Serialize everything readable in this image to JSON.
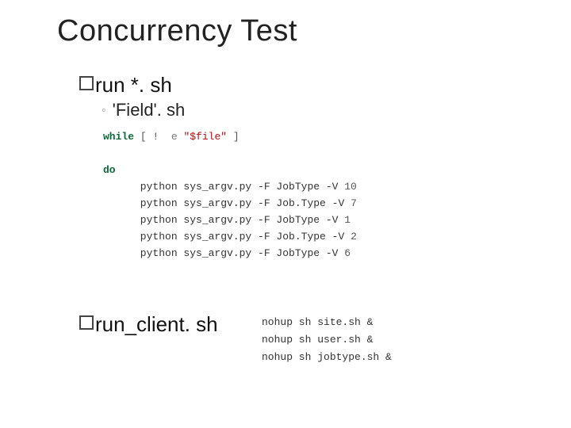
{
  "title": "Concurrency Test",
  "bullet1": {
    "label": "run *. sh"
  },
  "sub1": {
    "label": "'Field'. sh"
  },
  "code1": {
    "lines": [
      {
        "tokens": [
          {
            "t": "kw",
            "v": "while"
          },
          {
            "t": "plain",
            "v": " "
          },
          {
            "t": "punc",
            "v": "[ !"
          },
          {
            "t": "dim",
            "v": "  e "
          },
          {
            "t": "str",
            "v": "\"$file\""
          },
          {
            "t": "plain",
            "v": " "
          },
          {
            "t": "punc",
            "v": "]"
          }
        ]
      },
      {
        "tokens": []
      },
      {
        "tokens": [
          {
            "t": "kw",
            "v": "do"
          }
        ]
      },
      {
        "tokens": [
          {
            "t": "plain",
            "v": "      python sys_argv.py -F JobType -V "
          },
          {
            "t": "num",
            "v": "10"
          }
        ]
      },
      {
        "tokens": [
          {
            "t": "plain",
            "v": "      python sys_argv.py -F Job.Type -V "
          },
          {
            "t": "num",
            "v": "7"
          }
        ]
      },
      {
        "tokens": [
          {
            "t": "plain",
            "v": "      python sys_argv.py -F JobType -V "
          },
          {
            "t": "num",
            "v": "1"
          }
        ]
      },
      {
        "tokens": [
          {
            "t": "plain",
            "v": "      python sys_argv.py -F Job.Type -V "
          },
          {
            "t": "num",
            "v": "2"
          }
        ]
      },
      {
        "tokens": [
          {
            "t": "plain",
            "v": "      python sys_argv.py -F JobType -V "
          },
          {
            "t": "num",
            "v": "6"
          }
        ]
      }
    ]
  },
  "bullet2": {
    "label": "run_client. sh"
  },
  "code2": {
    "lines": [
      "nohup sh site.sh &",
      "nohup sh user.sh &",
      "nohup sh jobtype.sh &"
    ]
  }
}
